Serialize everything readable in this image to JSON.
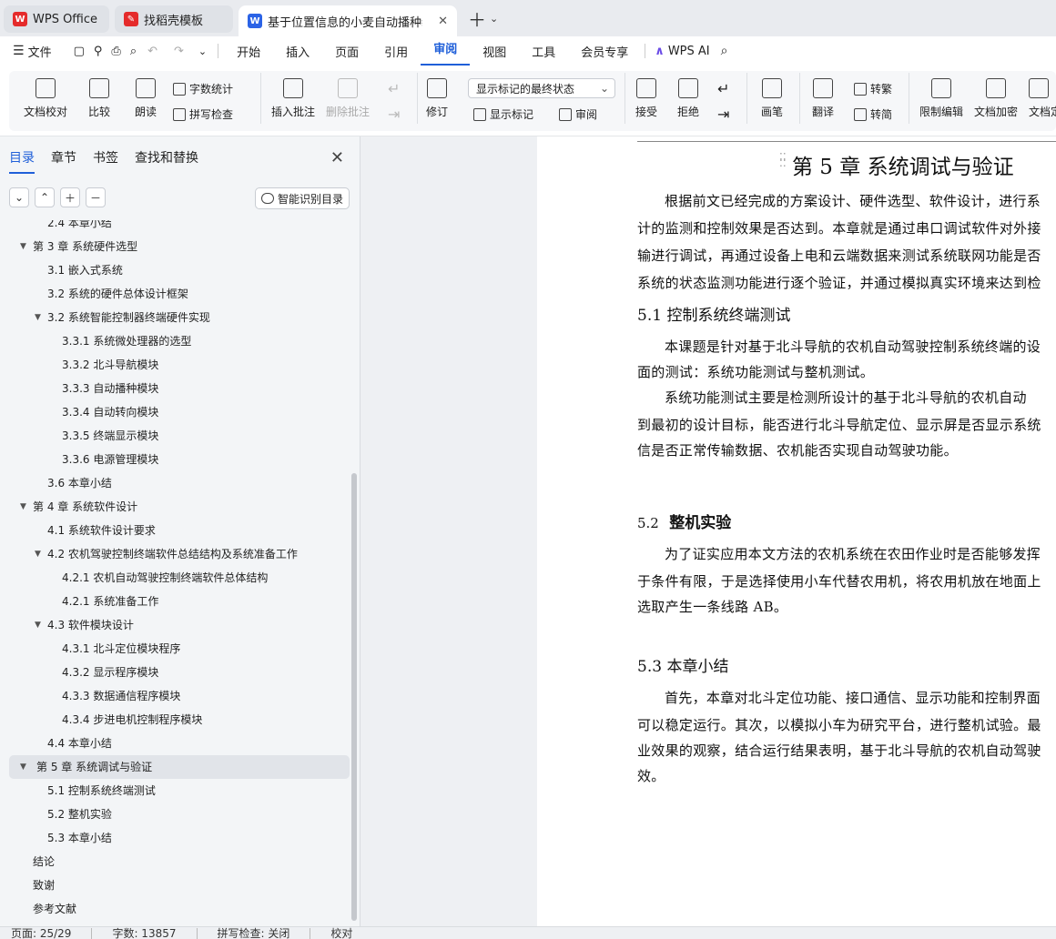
{
  "tabs": [
    {
      "label": "WPS Office",
      "logo_color": "#e52b2b"
    },
    {
      "label": "找稻壳模板",
      "logo_color": "#e52b2b"
    },
    {
      "label": "基于位置信息的小麦自动播种装",
      "logo_color": "#2b63e6",
      "active": true
    }
  ],
  "menu": {
    "file": "文件",
    "items": [
      "开始",
      "插入",
      "页面",
      "引用",
      "审阅",
      "视图",
      "工具",
      "会员专享"
    ],
    "active": "审阅",
    "ai": "WPS AI"
  },
  "ribbon": {
    "doc_check": "文档校对",
    "compare": "比较",
    "read": "朗读",
    "word_count": "字数统计",
    "spell_check": "拼写检查",
    "insert_comment": "插入批注",
    "delete_comment": "删除批注",
    "revise": "修订",
    "markup_select": "显示标记的最终状态",
    "show_markup": "显示标记",
    "review_pane": "审阅",
    "accept": "接受",
    "reject": "拒绝",
    "pen": "画笔",
    "translate": "翻译",
    "to_traditional": "转繁",
    "to_simplified": "转简",
    "restrict_edit": "限制编辑",
    "encrypt": "文档加密",
    "doc_more": "文档定"
  },
  "left_panel": {
    "tabs": [
      "目录",
      "章节",
      "书签",
      "查找和替换"
    ],
    "active_tab": "目录",
    "smart_toc": "智能识别目录",
    "toc": [
      {
        "text": "2.4  本章小结",
        "level": 2,
        "partial": true
      },
      {
        "text": "第 3 章  系统硬件选型",
        "level": 1,
        "expanded": true
      },
      {
        "text": "3.1  嵌入式系统",
        "level": 2
      },
      {
        "text": "3.2  系统的硬件总体设计框架",
        "level": 2
      },
      {
        "text": "3.2  系统智能控制器终端硬件实现",
        "level": 2,
        "expanded": true
      },
      {
        "text": "3.3.1  系统微处理器的选型",
        "level": 3
      },
      {
        "text": "3.3.2  北斗导航模块",
        "level": 3
      },
      {
        "text": "3.3.3  自动播种模块",
        "level": 3
      },
      {
        "text": "3.3.4  自动转向模块",
        "level": 3
      },
      {
        "text": "3.3.5  终端显示模块",
        "level": 3
      },
      {
        "text": "3.3.6  电源管理模块",
        "level": 3
      },
      {
        "text": "3.6  本章小结",
        "level": 2
      },
      {
        "text": "第 4 章  系统软件设计",
        "level": 1,
        "expanded": true
      },
      {
        "text": "4.1  系统软件设计要求",
        "level": 2
      },
      {
        "text": "4.2  农机驾驶控制终端软件总结结构及系统准备工作",
        "level": 2,
        "expanded": true
      },
      {
        "text": "4.2.1  农机自动驾驶控制终端软件总体结构",
        "level": 3
      },
      {
        "text": "4.2.1  系统准备工作",
        "level": 3
      },
      {
        "text": "4.3  软件模块设计",
        "level": 2,
        "expanded": true
      },
      {
        "text": "4.3.1  北斗定位模块程序",
        "level": 3
      },
      {
        "text": "4.3.2  显示程序模块",
        "level": 3
      },
      {
        "text": "4.3.3  数据通信程序模块",
        "level": 3
      },
      {
        "text": "4.3.4  步进电机控制程序模块",
        "level": 3
      },
      {
        "text": "4.4  本章小结",
        "level": 2
      },
      {
        "text": "第 5 章  系统调试与验证",
        "level": 1,
        "expanded": true,
        "selected": true
      },
      {
        "text": "5.1  控制系统终端测试",
        "level": 2
      },
      {
        "text": "5.2  整机实验",
        "level": 2
      },
      {
        "text": "5.3  本章小结",
        "level": 2
      },
      {
        "text": "结论",
        "level": 1
      },
      {
        "text": "致谢",
        "level": 1
      },
      {
        "text": "参考文献",
        "level": 1
      }
    ]
  },
  "document": {
    "chapter_title": "第 5 章  系统调试与验证",
    "intro": [
      "根据前文已经完成的方案设计、硬件选型、软件设计，进行系",
      "计的监测和控制效果是否达到。本章就是通过串口调试软件对外接",
      "输进行调试，再通过设备上电和云端数据来测试系统联网功能是否",
      "系统的状态监测功能进行逐个验证，并通过模拟真实环境来达到检"
    ],
    "s51_title": "5.1  控制系统终端测试",
    "s51_p1": [
      "本课题是针对基于北斗导航的农机自动驾驶控制系统终端的设",
      "面的测试：系统功能测试与整机测试。"
    ],
    "s51_p2": [
      "系统功能测试主要是检测所设计的基于北斗导航的农机自动",
      "到最初的设计目标，能否进行北斗导航定位、显示屏是否显示系统",
      "信是否正常传输数据、农机能否实现自动驾驶功能。"
    ],
    "s52_num": "5.2",
    "s52_title": "整机实验",
    "s52_p": [
      "为了证实应用本文方法的农机系统在农田作业时是否能够发挥",
      "于条件有限，于是选择使用小车代替农用机，将农用机放在地面上",
      "选取产生一条线路 AB。"
    ],
    "s53_title": "5.3  本章小结",
    "s53_p": [
      "首先，本章对北斗定位功能、接口通信、显示功能和控制界面",
      "可以稳定运行。其次，以模拟小车为研究平台，进行整机试验。最",
      "业效果的观察，结合运行结果表明，基于北斗导航的农机自动驾驶",
      "效。"
    ]
  },
  "status": {
    "page": "页面: 25/29",
    "words": "字数: 13857",
    "spell": "拼写检查: 关闭",
    "proof": "校对"
  },
  "colors": {
    "accent": "#1f5fd9",
    "wps_red": "#e52b2b"
  }
}
